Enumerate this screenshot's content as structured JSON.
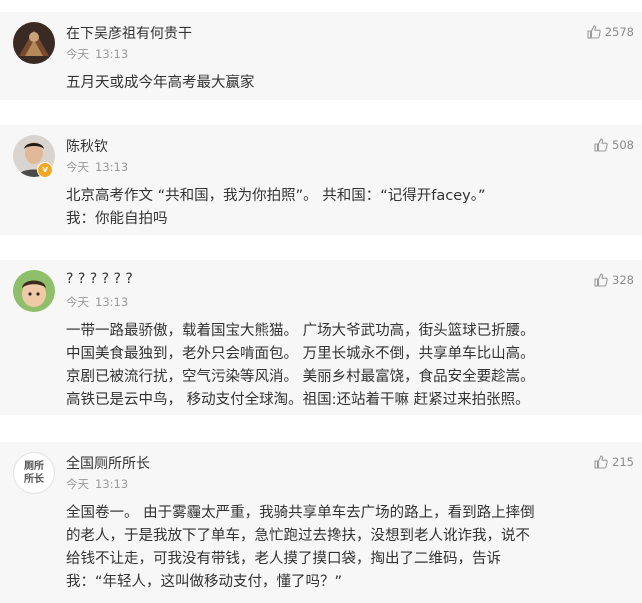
{
  "comments": [
    {
      "username": "在下吴彦祖有何贵干",
      "date": "今天",
      "time": "13:13",
      "likes": "2578",
      "lines": [
        "五月天或成今年高考最大赢家"
      ]
    },
    {
      "username": "陈秋钦",
      "date": "今天",
      "time": "13:13",
      "likes": "508",
      "verified_badge": "v",
      "lines": [
        "北京高考作文 “共和国，我为你拍照”。 共和国：“记得开facey。”",
        "我：你能自拍吗"
      ]
    },
    {
      "username": "? ? ? ? ? ?",
      "date": "今天",
      "time": "13:13",
      "likes": "328",
      "lines": [
        "一带一路最骄傲，载着国宝大熊猫。 广场大爷武功高，街头篮球已折腰。",
        "中国美食最独到，老外只会啃面包。 万里长城永不倒，共享单车比山高。",
        "京剧已被流行扰，空气污染等风消。 美丽乡村最富饶，食品安全要趁嵩。",
        "高铁已是云中鸟， 移动支付全球淘。祖国:还站着干嘛 赶紧过来拍张照。"
      ]
    },
    {
      "username": "全国厕所所长",
      "avatar_text": [
        "厕所",
        "所长"
      ],
      "date": "今天",
      "time": "13:13",
      "likes": "215",
      "lines": [
        "全国卷一。 由于雾霾太严重，我骑共享单车去广场的路上，看到路上摔倒",
        "的老人，于是我放下了单车，急忙跑过去搀扶，没想到老人讹诈我，说不",
        "给钱不让走，可我没有带钱，老人摸了摸口袋，掏出了二维码，告诉",
        "我：“年轻人，这叫做移动支付，懂了吗？”"
      ]
    }
  ],
  "colors": {
    "card_bg": "#f7f7f7",
    "text": "#333333",
    "meta": "#9a9a9a",
    "badge": "#f5a623"
  }
}
